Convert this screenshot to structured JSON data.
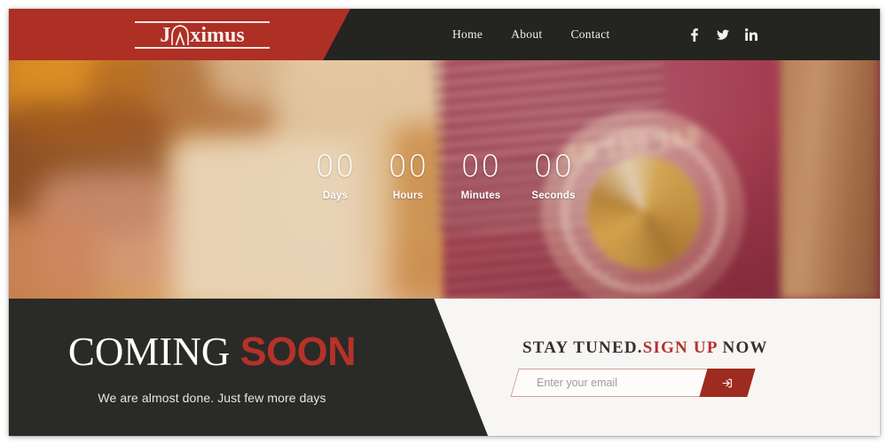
{
  "theme": {
    "red": "#ae2f24",
    "red_dark": "#9e2a20",
    "accent_red": "#b5322a",
    "dark": "#2a2a27",
    "header_dark": "#242420",
    "light": "#f7f6f4",
    "white": "#ffffff"
  },
  "header": {
    "logo": {
      "text_before": "J",
      "icon": "arch-mark",
      "text_after": "ximus",
      "full": "JAximus"
    },
    "nav": [
      {
        "label": "Home",
        "name": "nav-item-home"
      },
      {
        "label": "About",
        "name": "nav-item-about"
      },
      {
        "label": "Contact",
        "name": "nav-item-contact"
      }
    ],
    "socials": [
      {
        "label": "f",
        "icon": "facebook-icon"
      },
      {
        "label": "t",
        "icon": "twitter-icon"
      },
      {
        "label": "in",
        "icon": "linkedin-icon"
      }
    ]
  },
  "hero": {
    "background": "blurred vintage red radio photograph",
    "dial_numbers": "60 140 110",
    "countdown": [
      {
        "value": "00",
        "label": "Days"
      },
      {
        "value": "00",
        "label": "Hours"
      },
      {
        "value": "00",
        "label": "Minutes"
      },
      {
        "value": "00",
        "label": "Seconds"
      }
    ]
  },
  "bottom": {
    "coming": {
      "word_light": "COMING",
      "word_bold": "SOON",
      "subtitle": "We are almost done. Just few more days"
    },
    "signup": {
      "heading_part1": "STAY TUNED.",
      "heading_part2": "SIGN UP",
      "heading_part3": " NOW",
      "email_placeholder": "Enter your email",
      "email_value": "",
      "submit_icon": "sign-in-arrow-icon"
    }
  }
}
